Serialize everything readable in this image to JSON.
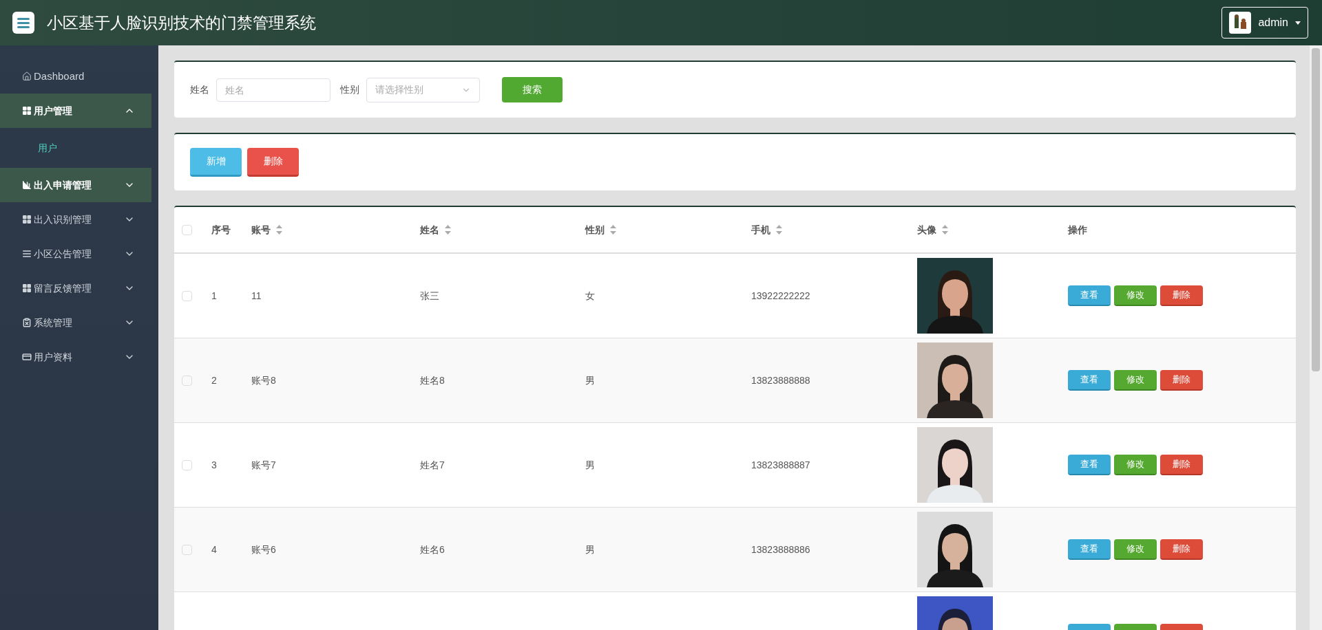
{
  "header": {
    "title": "小区基于人脸识别技术的门禁管理系统",
    "user": {
      "name": "admin"
    }
  },
  "sidebar": {
    "items": [
      {
        "label": "Dashboard",
        "highlighted": false
      },
      {
        "label": "用户管理",
        "highlighted": true,
        "expanded": true,
        "children": [
          {
            "label": "用户",
            "selected": true
          }
        ]
      },
      {
        "label": "出入申请管理",
        "highlighted": true,
        "expanded": false
      },
      {
        "label": "出入识别管理",
        "highlighted": false,
        "expanded": false
      },
      {
        "label": "小区公告管理",
        "highlighted": false,
        "expanded": false
      },
      {
        "label": "留言反馈管理",
        "highlighted": false,
        "expanded": false
      },
      {
        "label": "系统管理",
        "highlighted": false,
        "expanded": false
      },
      {
        "label": "用户资料",
        "highlighted": false,
        "expanded": false
      }
    ]
  },
  "search": {
    "fields": [
      {
        "label": "姓名",
        "kind": "input",
        "placeholder": "姓名"
      },
      {
        "label": "性别",
        "kind": "select",
        "placeholder": "请选择性别"
      }
    ],
    "button": "搜索"
  },
  "actions": [
    {
      "label": "新增",
      "kind": "add"
    },
    {
      "label": "删除",
      "kind": "delete"
    }
  ],
  "table": {
    "select_all": {
      "checked": false
    },
    "columns": [
      {
        "label": "序号",
        "sortable": false
      },
      {
        "label": "账号",
        "sortable": true
      },
      {
        "label": "姓名",
        "sortable": true
      },
      {
        "label": "性别",
        "sortable": true
      },
      {
        "label": "手机",
        "sortable": true
      },
      {
        "label": "头像",
        "sortable": true
      },
      {
        "label": "操作",
        "sortable": false
      }
    ],
    "rows": [
      {
        "checked": false,
        "index": "1",
        "account": "11",
        "name": "张三",
        "sex": "女",
        "phone": "13922222222",
        "actions": [
          {
            "label": "查看",
            "kind": "view"
          },
          {
            "label": "修改",
            "kind": "edit"
          },
          {
            "label": "删除",
            "kind": "delete"
          }
        ]
      },
      {
        "checked": false,
        "index": "2",
        "account": "账号8",
        "name": "姓名8",
        "sex": "男",
        "phone": "13823888888",
        "actions": [
          {
            "label": "查看",
            "kind": "view"
          },
          {
            "label": "修改",
            "kind": "edit"
          },
          {
            "label": "删除",
            "kind": "delete"
          }
        ]
      },
      {
        "checked": false,
        "index": "3",
        "account": "账号7",
        "name": "姓名7",
        "sex": "男",
        "phone": "13823888887",
        "actions": [
          {
            "label": "查看",
            "kind": "view"
          },
          {
            "label": "修改",
            "kind": "edit"
          },
          {
            "label": "删除",
            "kind": "delete"
          }
        ]
      },
      {
        "checked": false,
        "index": "4",
        "account": "账号6",
        "name": "姓名6",
        "sex": "男",
        "phone": "13823888886",
        "actions": [
          {
            "label": "查看",
            "kind": "view"
          },
          {
            "label": "修改",
            "kind": "edit"
          },
          {
            "label": "删除",
            "kind": "delete"
          }
        ]
      },
      {
        "actions": [
          {
            "kind": "view"
          },
          {
            "kind": "edit"
          },
          {
            "kind": "delete"
          }
        ]
      }
    ]
  }
}
